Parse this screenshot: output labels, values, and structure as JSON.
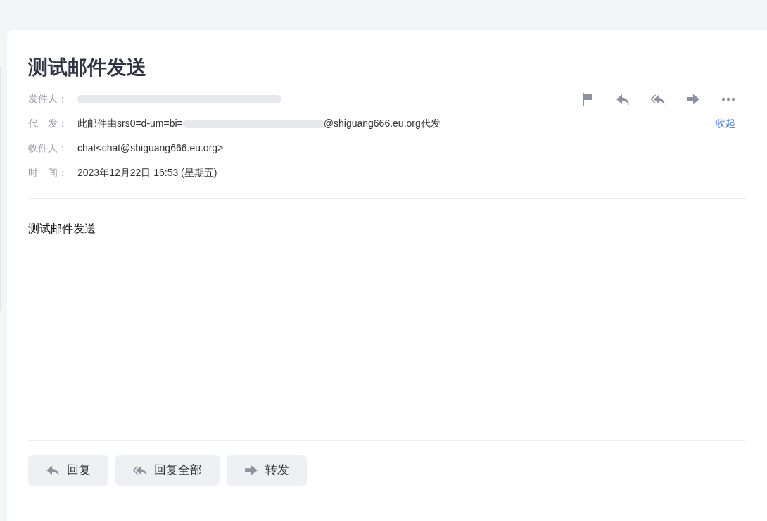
{
  "email": {
    "title": "测试邮件发送",
    "headers": [
      {
        "label": "发件人：",
        "segments": [
          {
            "kind": "redacted"
          }
        ]
      },
      {
        "label": "代　发：",
        "segments": [
          {
            "kind": "text",
            "text": "此邮件由srs0=d-um=bi="
          },
          {
            "kind": "redacted"
          },
          {
            "kind": "text",
            "text": "@shiguang666.eu.org代发"
          }
        ],
        "action": "收起"
      },
      {
        "label": "收件人：",
        "segments": [
          {
            "kind": "text",
            "text": "chat<chat@shiguang666.eu.org>"
          }
        ]
      },
      {
        "label": "时　间：",
        "segments": [
          {
            "kind": "text",
            "text": "2023年12月22日 16:53 (星期五)"
          }
        ]
      }
    ],
    "body": "测试邮件发送",
    "buttons": [
      {
        "kind": "reply",
        "label": "回复"
      },
      {
        "kind": "reply_all",
        "label": "回复全部"
      },
      {
        "kind": "forward",
        "label": "转发"
      }
    ]
  }
}
